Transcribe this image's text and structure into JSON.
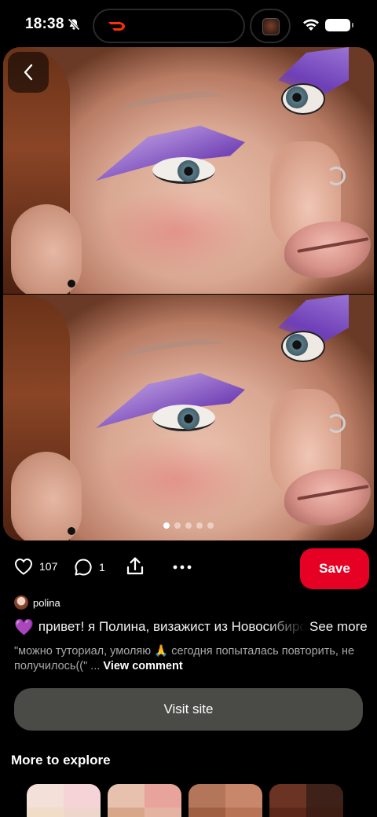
{
  "status_bar": {
    "time": "18:38",
    "icons": [
      "bell-slash-icon",
      "doordash-logo",
      "live-activity-thumbnail",
      "wifi-icon",
      "battery-icon"
    ]
  },
  "media": {
    "back_icon": "chevron-left-icon",
    "carousel_count": 5,
    "carousel_active": 1
  },
  "actions": {
    "like_count": "107",
    "comment_count": "1",
    "save_label": "Save"
  },
  "author": {
    "name": "polina"
  },
  "description": {
    "emoji": "💜",
    "text": "привет! я Полина, визажист из Новосибирска",
    "see_more": "See more"
  },
  "comment_preview": {
    "text": "\"можно туториал, умоляю 🙏 сегодня попыталась повторить, не получилось((\" ... ",
    "view_comment": "View comment"
  },
  "visit_site": "Visit site",
  "explore": {
    "title": "More to explore",
    "tiles": [
      {
        "colors": [
          "#f3e0d8",
          "#f6d3d6",
          "#f1dcc7",
          "#efd6cd"
        ]
      },
      {
        "colors": [
          "#e8c0ae",
          "#e7a39c",
          "#d8a78a",
          "#e5b3a1"
        ]
      },
      {
        "colors": [
          "#b4765a",
          "#c8866a",
          "#a05e43",
          "#b87356"
        ]
      },
      {
        "colors": [
          "#6b3324",
          "#3e2118",
          "#5c2618",
          "#3d1d14"
        ]
      }
    ]
  },
  "colors": {
    "accent": "#e60023",
    "background": "#000000",
    "button_dark": "#4a4a46"
  }
}
